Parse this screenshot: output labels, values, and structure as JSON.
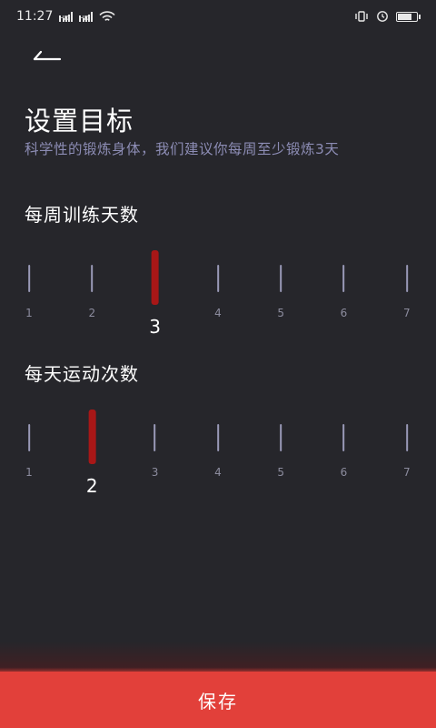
{
  "status_bar": {
    "time": "11:27"
  },
  "title": "设置目标",
  "subtitle": "科学性的锻炼身体，我们建议你每周至少锻炼3天",
  "weekly": {
    "label": "每周训练天数",
    "options": [
      "1",
      "2",
      "3",
      "4",
      "5",
      "6",
      "7"
    ],
    "selected": 3
  },
  "daily": {
    "label": "每天运动次数",
    "options": [
      "1",
      "2",
      "3",
      "4",
      "5",
      "6",
      "7"
    ],
    "selected": 2
  },
  "save_label": "保存",
  "colors": {
    "background": "#26262b",
    "accent": "#e2403a",
    "selected_tick": "#a81717"
  }
}
